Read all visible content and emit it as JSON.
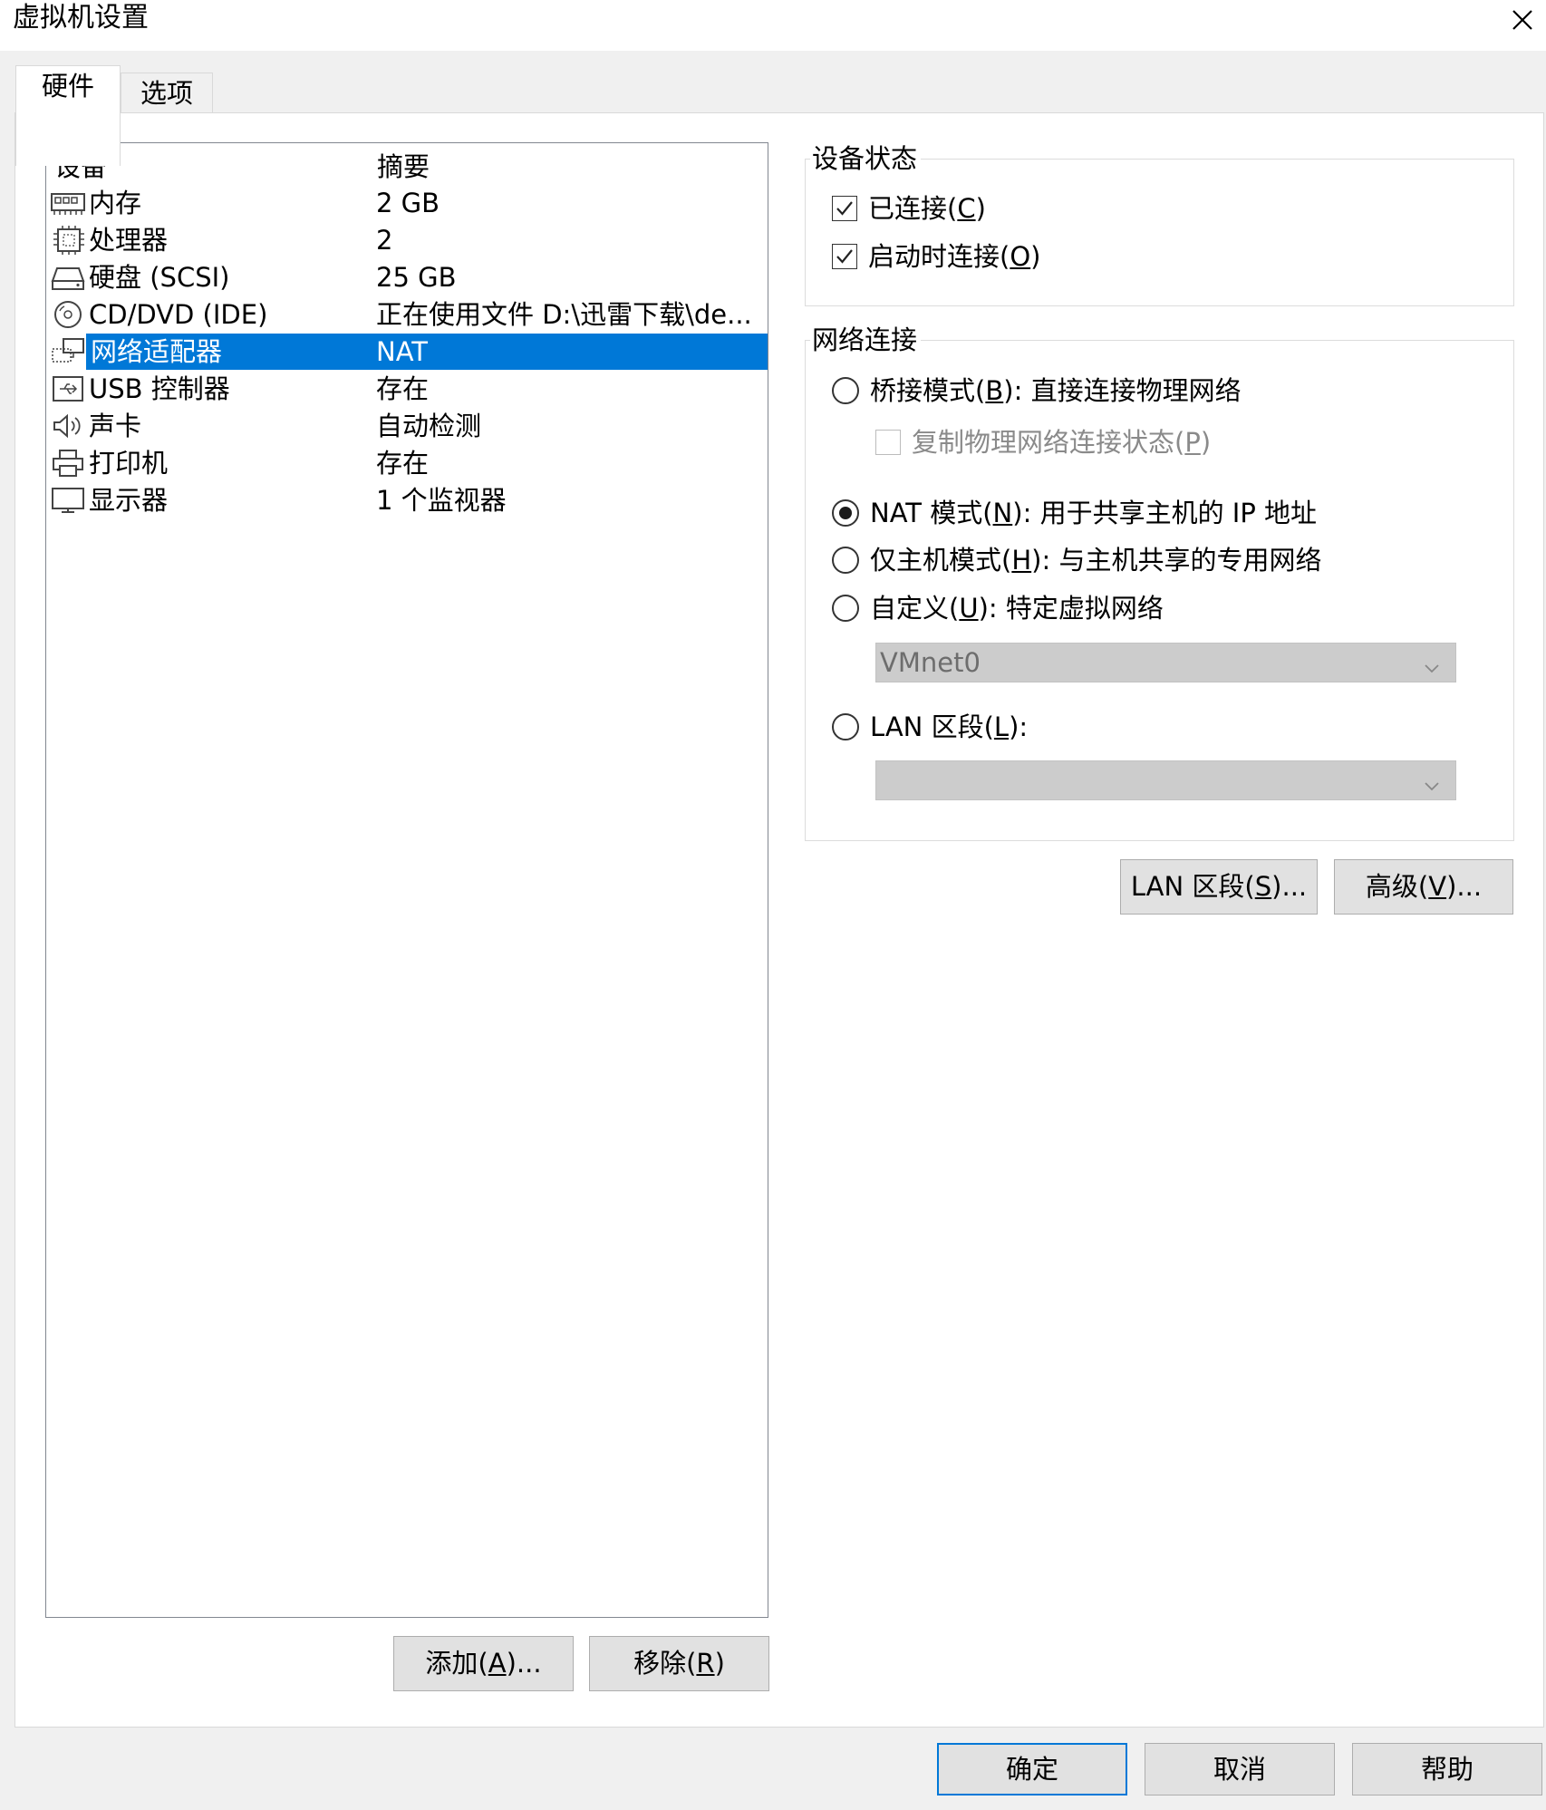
{
  "window": {
    "title": "虚拟机设置"
  },
  "tabs": [
    {
      "label": "硬件"
    },
    {
      "label": "选项"
    }
  ],
  "device_list": {
    "headers": {
      "device": "设备",
      "summary": "摘要"
    },
    "rows": [
      {
        "icon": "memory-icon",
        "name": "内存",
        "summary": "2 GB"
      },
      {
        "icon": "processor-icon",
        "name": "处理器",
        "summary": "2"
      },
      {
        "icon": "hard-disk-icon",
        "name": "硬盘 (SCSI)",
        "summary": "25 GB"
      },
      {
        "icon": "cd-dvd-icon",
        "name": "CD/DVD (IDE)",
        "summary": "正在使用文件 D:\\迅雷下载\\de..."
      },
      {
        "icon": "network-adapter-icon",
        "name": "网络适配器",
        "summary": "NAT",
        "selected": true
      },
      {
        "icon": "usb-icon",
        "name": "USB 控制器",
        "summary": "存在"
      },
      {
        "icon": "speaker-icon",
        "name": "声卡",
        "summary": "自动检测"
      },
      {
        "icon": "printer-icon",
        "name": "打印机",
        "summary": "存在"
      },
      {
        "icon": "monitor-icon",
        "name": "显示器",
        "summary": "1 个监视器"
      }
    ]
  },
  "device_status": {
    "title": "设备状态",
    "connected": {
      "label": "已连接",
      "key": "C",
      "checked": true
    },
    "connect_at_power_on": {
      "label": "启动时连接",
      "key": "O",
      "checked": true
    }
  },
  "network": {
    "title": "网络连接",
    "bridged": {
      "label": "桥接模式",
      "key": "B",
      "desc": ": 直接连接物理网络",
      "selected": false
    },
    "replicate": {
      "label": "复制物理网络连接状态",
      "key": "P",
      "checked": false,
      "disabled": true
    },
    "nat": {
      "label": "NAT 模式",
      "key": "N",
      "desc": ": 用于共享主机的 IP 地址",
      "selected": true
    },
    "hostonly": {
      "label": "仅主机模式",
      "key": "H",
      "desc": ": 与主机共享的专用网络",
      "selected": false
    },
    "custom": {
      "label": "自定义",
      "key": "U",
      "desc": ": 特定虚拟网络",
      "selected": false
    },
    "custom_select": {
      "value": "VMnet0"
    },
    "lan": {
      "label": "LAN 区段",
      "key": "L",
      "desc": ":",
      "selected": false
    },
    "lan_select": {
      "value": ""
    }
  },
  "buttons": {
    "lan_segments": {
      "label": "LAN 区段",
      "key": "S",
      "suffix": "..."
    },
    "advanced": {
      "label": "高级",
      "key": "V",
      "suffix": "..."
    },
    "add": {
      "label": "添加",
      "key": "A",
      "suffix": "..."
    },
    "remove": {
      "label": "移除",
      "key": "R",
      "suffix": ""
    },
    "ok": {
      "label": "确定"
    },
    "cancel": {
      "label": "取消"
    },
    "help": {
      "label": "帮助"
    }
  },
  "colors": {
    "selection": "#0078d7",
    "dialog_bg": "#f0f0f0",
    "default_button_border": "#0078d7"
  }
}
